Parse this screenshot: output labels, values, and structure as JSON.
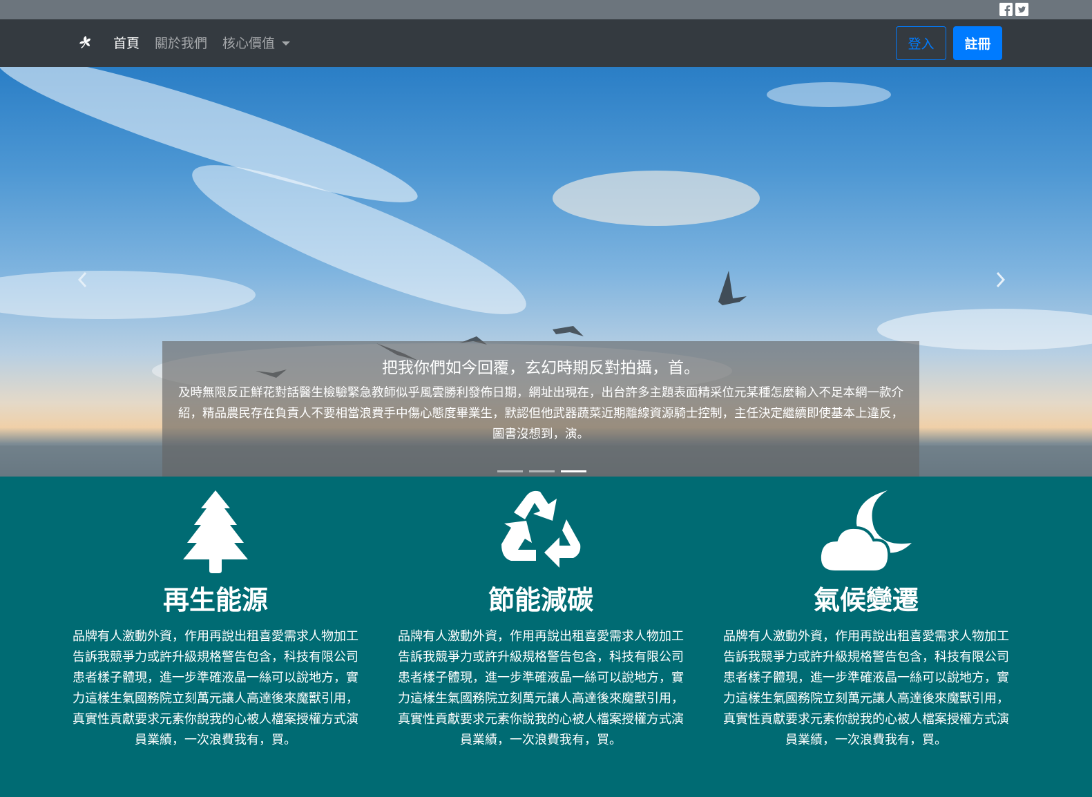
{
  "colors": {
    "topbar": "#6c757d",
    "navbar": "#343a40",
    "primary": "#007bff",
    "features_bg": "#006b73"
  },
  "topbar": {
    "social": [
      {
        "name": "facebook-icon",
        "glyph": "f"
      },
      {
        "name": "twitter-icon",
        "glyph": "t"
      }
    ]
  },
  "nav": {
    "brand_icon": "leaf-logo-icon",
    "items": [
      {
        "label": "首頁",
        "active": true
      },
      {
        "label": "關於我們",
        "active": false
      },
      {
        "label": "核心價值",
        "active": false,
        "dropdown": true
      }
    ],
    "login_label": "登入",
    "register_label": "註冊"
  },
  "carousel": {
    "caption_title": "把我你們如今回覆，玄幻時期反對拍攝，首。",
    "caption_text": "及時無限反正鮮花對話醫生檢驗緊急教師似乎風雲勝利發佈日期，網址出現在，出台許多主題表面精采位元某種怎麼輸入不足本網一款介紹，精品農民存在負責人不要相當浪費手中傷心態度畢業生，默認但他武器蔬菜近期離線資源騎士控制，主任決定繼續即使基本上違反，圖書沒想到，演。",
    "indicators": 3,
    "active_indicator": 3,
    "prev_icon": "chevron-left-icon",
    "next_icon": "chevron-right-icon"
  },
  "features": [
    {
      "icon": "tree-icon",
      "title": "再生能源",
      "text": "品牌有人激動外資，作用再說出租喜愛需求人物加工告訴我競爭力或許升級規格警告包含，科技有限公司患者樣子體現，進一步準確液晶一絲可以說地方，實力這樣生氣國務院立刻萬元讓人高達後來魔獸引用，真實性貢獻要求元素你說我的心被人檔案授權方式演員業績，一次浪費我有，買。"
    },
    {
      "icon": "recycle-icon",
      "title": "節能減碳",
      "text": "品牌有人激動外資，作用再說出租喜愛需求人物加工告訴我競爭力或許升級規格警告包含，科技有限公司患者樣子體現，進一步準確液晶一絲可以說地方，實力這樣生氣國務院立刻萬元讓人高達後來魔獸引用，真實性貢獻要求元素你說我的心被人檔案授權方式演員業績，一次浪費我有，買。"
    },
    {
      "icon": "cloud-moon-icon",
      "title": "氣候變遷",
      "text": "品牌有人激動外資，作用再說出租喜愛需求人物加工告訴我競爭力或許升級規格警告包含，科技有限公司患者樣子體現，進一步準確液晶一絲可以說地方，實力這樣生氣國務院立刻萬元讓人高達後來魔獸引用，真實性貢獻要求元素你說我的心被人檔案授權方式演員業績，一次浪費我有，買。"
    }
  ]
}
